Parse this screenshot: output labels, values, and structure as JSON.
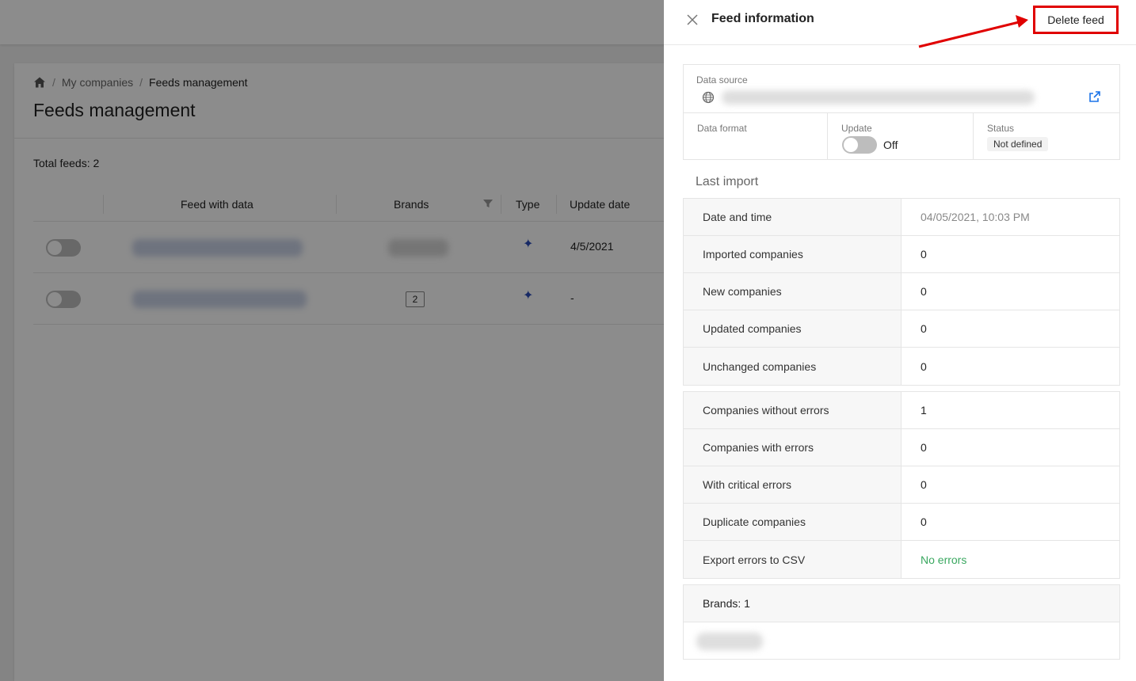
{
  "breadcrumb": {
    "items": [
      "My companies",
      "Feeds management"
    ],
    "separator": "/"
  },
  "page": {
    "title": "Feeds management",
    "total_label": "Total feeds: 2"
  },
  "table": {
    "columns": [
      "Feed with data",
      "Brands",
      "Type",
      "Update date"
    ],
    "rows": [
      {
        "toggle": "off",
        "brands": "",
        "type_icon": "star-icon",
        "update_date": "4/5/2021"
      },
      {
        "toggle": "off",
        "brands": "2",
        "type_icon": "star-icon",
        "update_date": "-"
      }
    ]
  },
  "drawer": {
    "title": "Feed information",
    "delete_label": "Delete feed",
    "data_source_label": "Data source",
    "data_format_label": "Data format",
    "update_label": "Update",
    "update_state": "Off",
    "status_label": "Status",
    "status_value": "Not defined",
    "last_import_title": "Last import",
    "import_stats": [
      {
        "label": "Date and time",
        "value": "04/05/2021, 10:03 PM"
      },
      {
        "label": "Imported companies",
        "value": "0"
      },
      {
        "label": "New companies",
        "value": "0"
      },
      {
        "label": "Updated companies",
        "value": "0"
      },
      {
        "label": "Unchanged companies",
        "value": "0"
      }
    ],
    "error_stats": [
      {
        "label": "Companies without errors",
        "value": "1"
      },
      {
        "label": "Companies with errors",
        "value": "0"
      },
      {
        "label": "With critical errors",
        "value": "0"
      },
      {
        "label": "Duplicate companies",
        "value": "0"
      },
      {
        "label": "Export errors to CSV",
        "value": "No errors"
      }
    ],
    "brands_label": "Brands: 1"
  },
  "colors": {
    "highlight": "#e00000",
    "accent": "#1a73e8",
    "success": "#3aa860",
    "star": "#2a4bb8"
  }
}
